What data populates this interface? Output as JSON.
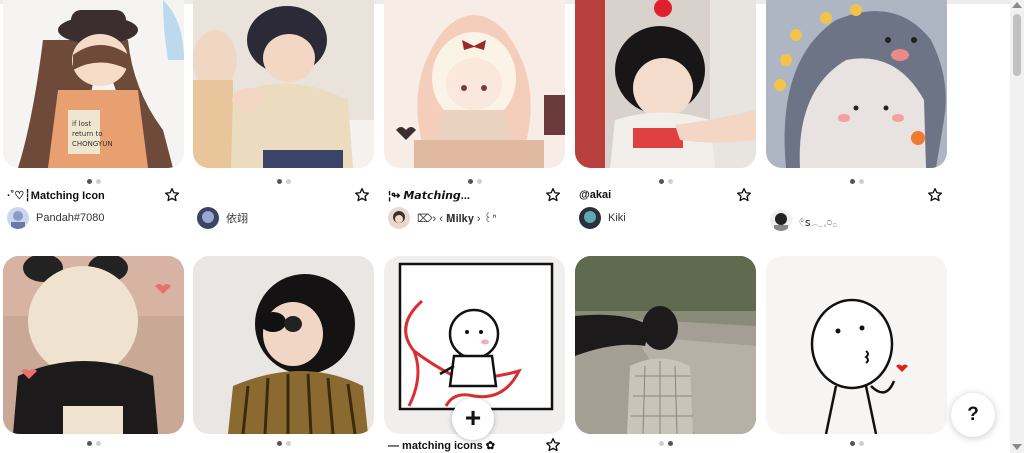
{
  "pins_row1": [
    {
      "title": "·˚♡┆Matching Icon",
      "user": "Pandah#7080",
      "image": "anime girl with hat matching icon",
      "active_dot": 0
    },
    {
      "title": "",
      "user": "依翊",
      "image": "toddler in beige sweater",
      "active_dot": 0
    },
    {
      "title": "¦↬ 𝙈𝙖𝙩𝙘𝙝𝙞𝙣𝙜...",
      "user": "⌦› ‹ 𝐌𝐢𝐥𝐤𝐲 › ꒰ᐢ",
      "image": "anime girl with bow drawing",
      "active_dot": 0
    },
    {
      "title": "@akai",
      "user": "Kiki",
      "image": "baby girl with bangs",
      "active_dot": 0
    },
    {
      "title": "",
      "user": "𓏲ꜱ𓂃𓈒𓏸𓂂",
      "image": "cartoon dinosaur costume",
      "active_dot": 0
    }
  ],
  "pins_row2": [
    {
      "title": "",
      "image": "child in panda hoodie",
      "active_dot": 0
    },
    {
      "title": "",
      "image": "child with sunglasses",
      "active_dot": 0
    },
    {
      "title": "— matching icons ✿",
      "image": "stick figure with red string",
      "active_dot": 0
    },
    {
      "title": "",
      "image": "couple holding heads on road",
      "active_dot": 1
    },
    {
      "title": "",
      "image": "stick figure blowing kiss",
      "active_dot": 0
    }
  ],
  "buttons": {
    "create": "+",
    "help": "?"
  },
  "icons": {
    "save": "star-outline-icon"
  },
  "colors": {
    "accent": "#111111",
    "dot_active": "#555555",
    "dot_inactive": "#cfcfcf"
  }
}
